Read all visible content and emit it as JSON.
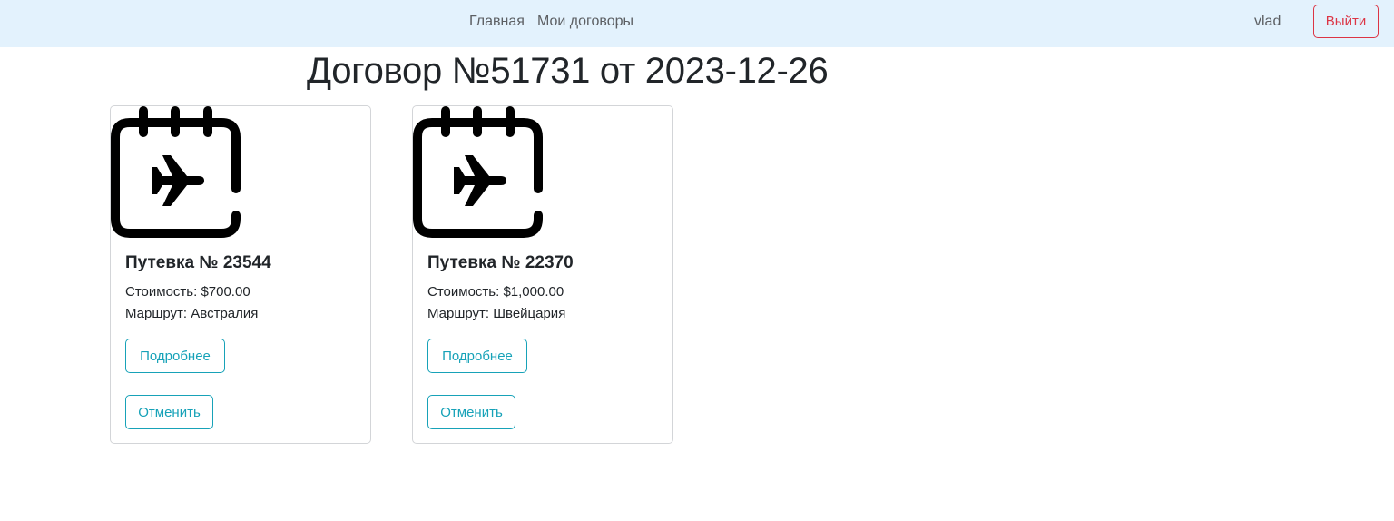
{
  "navbar": {
    "home_label": "Главная",
    "contracts_label": "Мои договоры",
    "username": "vlad",
    "logout_label": "Выйти"
  },
  "page": {
    "title": "Договор №51731 от 2023-12-26"
  },
  "colors": {
    "navbar_bg": "#e3f2fd",
    "danger": "#dc3545",
    "info": "#17a2b8"
  },
  "cards": [
    {
      "icon": "calendar-plane-icon",
      "title": "Путевка № 23544",
      "price_label": "Стоимость:",
      "price_value": "$700.00",
      "route_label": "Маршрут:",
      "route_value": "Австралия",
      "details_label": "Подробнее",
      "cancel_label": "Отменить"
    },
    {
      "icon": "calendar-plane-icon",
      "title": "Путевка № 22370",
      "price_label": "Стоимость:",
      "price_value": "$1,000.00",
      "route_label": "Маршрут:",
      "route_value": "Швейцария",
      "details_label": "Подробнее",
      "cancel_label": "Отменить"
    }
  ]
}
